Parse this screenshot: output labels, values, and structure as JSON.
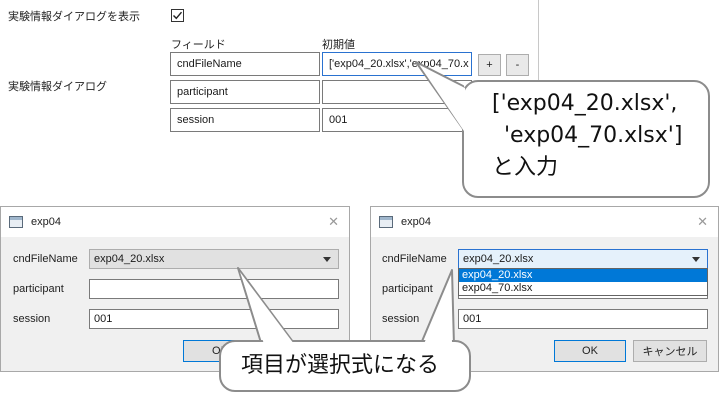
{
  "settings": {
    "show_dialog_label": "実験情報ダイアログを表示",
    "show_dialog_checked": true,
    "dialog_section_label": "実験情報ダイアログ",
    "column_field": "フィールド",
    "column_default": "初期値",
    "rows": [
      {
        "field": "cndFileName",
        "value": "['exp04_20.xlsx','exp04_70.x"
      },
      {
        "field": "participant",
        "value": ""
      },
      {
        "field": "session",
        "value": "001"
      }
    ],
    "add_label": "+",
    "remove_label": "-"
  },
  "callout_input": {
    "line1": "['exp04_20.xlsx',",
    "line2": "'exp04_70.xlsx']",
    "line3": "と入力"
  },
  "callout_select": {
    "text": "項目が選択式になる"
  },
  "dialog_left": {
    "title": "exp04",
    "close": "✕",
    "fields": [
      {
        "label": "cndFileName",
        "value": "exp04_20.xlsx"
      },
      {
        "label": "participant",
        "value": ""
      },
      {
        "label": "session",
        "value": "001"
      }
    ],
    "ok_label": "OK"
  },
  "dialog_right": {
    "title": "exp04",
    "close": "✕",
    "fields": [
      {
        "label": "cndFileName",
        "value": "exp04_20.xlsx"
      },
      {
        "label": "participant",
        "value": ""
      },
      {
        "label": "session",
        "value": "001"
      }
    ],
    "dropdown_options": [
      "exp04_20.xlsx",
      "exp04_70.xlsx"
    ],
    "selected_option_index": 0,
    "ok_label": "OK",
    "cancel_label": "キャンセル"
  },
  "colors": {
    "accent_blue": "#0078d7",
    "callout_border": "#8c8c8c",
    "dialog_bg": "#f0f0f0"
  }
}
